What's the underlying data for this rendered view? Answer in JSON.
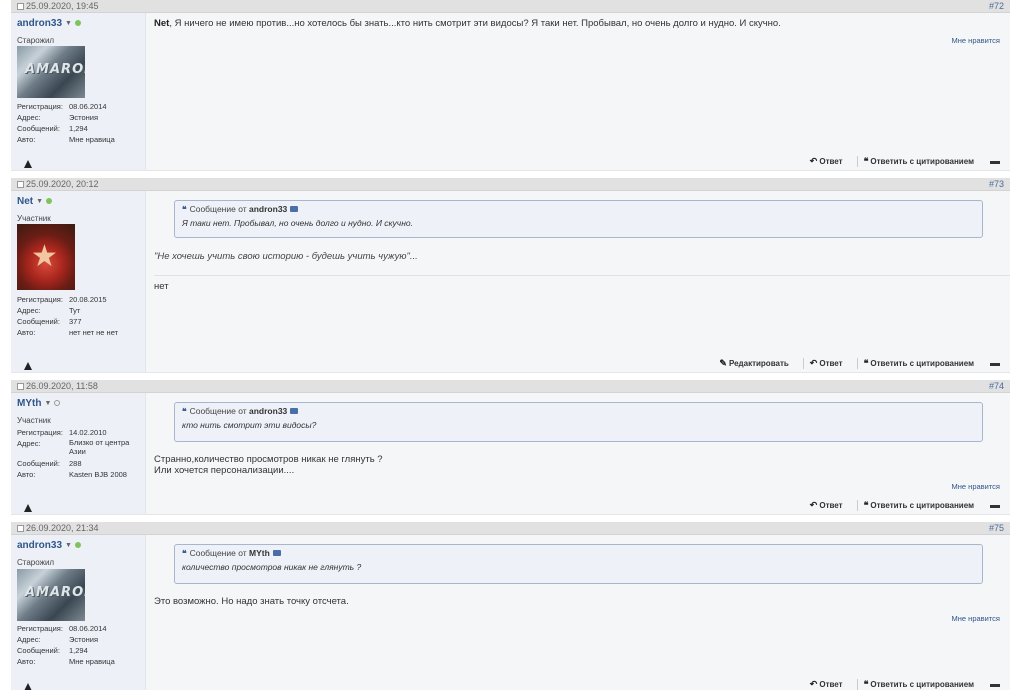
{
  "posts": [
    {
      "date": "25.09.2020, 19:45",
      "number": "#72",
      "user": {
        "name": "andron33",
        "role": "Старожил",
        "online": true,
        "avatar": "amarok",
        "avatar_text": "AMAROK",
        "stats": [
          {
            "label": "Регистрация:",
            "value": "08.06.2014"
          },
          {
            "label": "Адрес:",
            "value": "Эстония"
          },
          {
            "label": "Сообщений:",
            "value": "1,294"
          },
          {
            "label": "Авто:",
            "value": "Мне нравица"
          }
        ]
      },
      "message_bold": "Net",
      "message": ", Я ничего не имею против...но хотелось бы знать...кто нить смотрит эти видосы? Я таки нет. Пробывал, но очень долго и нудно. И скучно.",
      "like": "Мне нравится",
      "actions": [
        "Ответ",
        "Ответить с цитированием"
      ]
    },
    {
      "date": "25.09.2020, 20:12",
      "number": "#73",
      "user": {
        "name": "Net",
        "role": "Участник",
        "online": true,
        "avatar": "medal",
        "stats": [
          {
            "label": "Регистрация:",
            "value": "20.08.2015"
          },
          {
            "label": "Адрес:",
            "value": "Тут"
          },
          {
            "label": "Сообщений:",
            "value": "377"
          },
          {
            "label": "Авто:",
            "value": "нет нет не нет"
          }
        ]
      },
      "quote": {
        "prefix": "Сообщение от",
        "author": "andron33",
        "text": "Я таки нет. Пробывал, но очень долго и нудно. И скучно."
      },
      "signature": "\"Не хочешь учить свою историю - будешь учить чужую\"...",
      "message": "нет",
      "actions": [
        "Редактировать",
        "Ответ",
        "Ответить с цитированием"
      ]
    },
    {
      "date": "26.09.2020, 11:58",
      "number": "#74",
      "user": {
        "name": "MYth",
        "role": "Участник",
        "online": false,
        "stats": [
          {
            "label": "Регистрация:",
            "value": "14.02.2010"
          },
          {
            "label": "Адрес:",
            "value": "Близко от центра Азии"
          },
          {
            "label": "Сообщений:",
            "value": "288"
          },
          {
            "label": "Авто:",
            "value": "Kasten BJB 2008"
          }
        ]
      },
      "quote": {
        "prefix": "Сообщение от",
        "author": "andron33",
        "text": "кто нить смотрит эти видосы?"
      },
      "message_line1": "Странно,количество просмотров никак не глянуть ?",
      "message_line2": "Или хочется персонализации....",
      "like": "Мне нравится",
      "actions": [
        "Ответ",
        "Ответить с цитированием"
      ]
    },
    {
      "date": "26.09.2020, 21:34",
      "number": "#75",
      "user": {
        "name": "andron33",
        "role": "Старожил",
        "online": true,
        "avatar": "amarok",
        "avatar_text": "AMAROK",
        "stats": [
          {
            "label": "Регистрация:",
            "value": "08.06.2014"
          },
          {
            "label": "Адрес:",
            "value": "Эстония"
          },
          {
            "label": "Сообщений:",
            "value": "1,294"
          },
          {
            "label": "Авто:",
            "value": "Мне нравица"
          }
        ]
      },
      "quote": {
        "prefix": "Сообщение от",
        "author": "MYth",
        "text": "количество просмотров никак не глянуть ?"
      },
      "message": "Это возможно. Но надо знать точку отсчета.",
      "like": "Мне нравится",
      "actions": [
        "Ответ",
        "Ответить с цитированием"
      ]
    }
  ],
  "icons": {
    "warn": "warning-triangle-icon",
    "reply": "reply-arrow-icon",
    "quote": "quote-bubble-icon",
    "edit": "pencil-icon",
    "menu": "post-menu-icon"
  }
}
